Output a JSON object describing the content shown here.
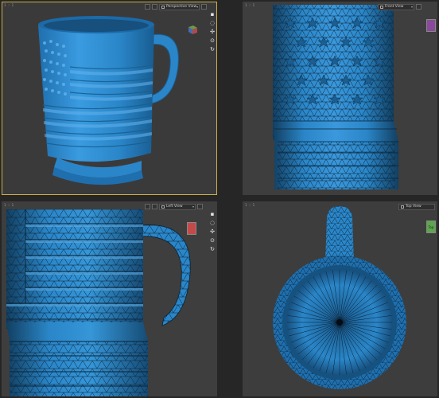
{
  "viewports": {
    "perspective": {
      "corner_label": "1 : 1",
      "view_name": "Perspective View"
    },
    "front": {
      "corner_label": "1 : 1",
      "view_name": "Front View"
    },
    "left": {
      "corner_label": "1 : 1",
      "view_name": "Left View"
    },
    "top": {
      "corner_label": "1 : 1",
      "view_name": "Top View",
      "cube_label": "Top"
    }
  },
  "tools": [
    "camera-icon",
    "orbit-icon",
    "pan-icon",
    "zoom-icon",
    "reset-icon"
  ],
  "colors": {
    "mesh": "#2a86c8",
    "mesh_dark": "#15466a",
    "wire": "#0b2236",
    "active_border": "#c9b04a",
    "cube_green": "#5aa84a",
    "cube_red": "#c44a4a",
    "cube_purple": "#8a4a9a"
  }
}
